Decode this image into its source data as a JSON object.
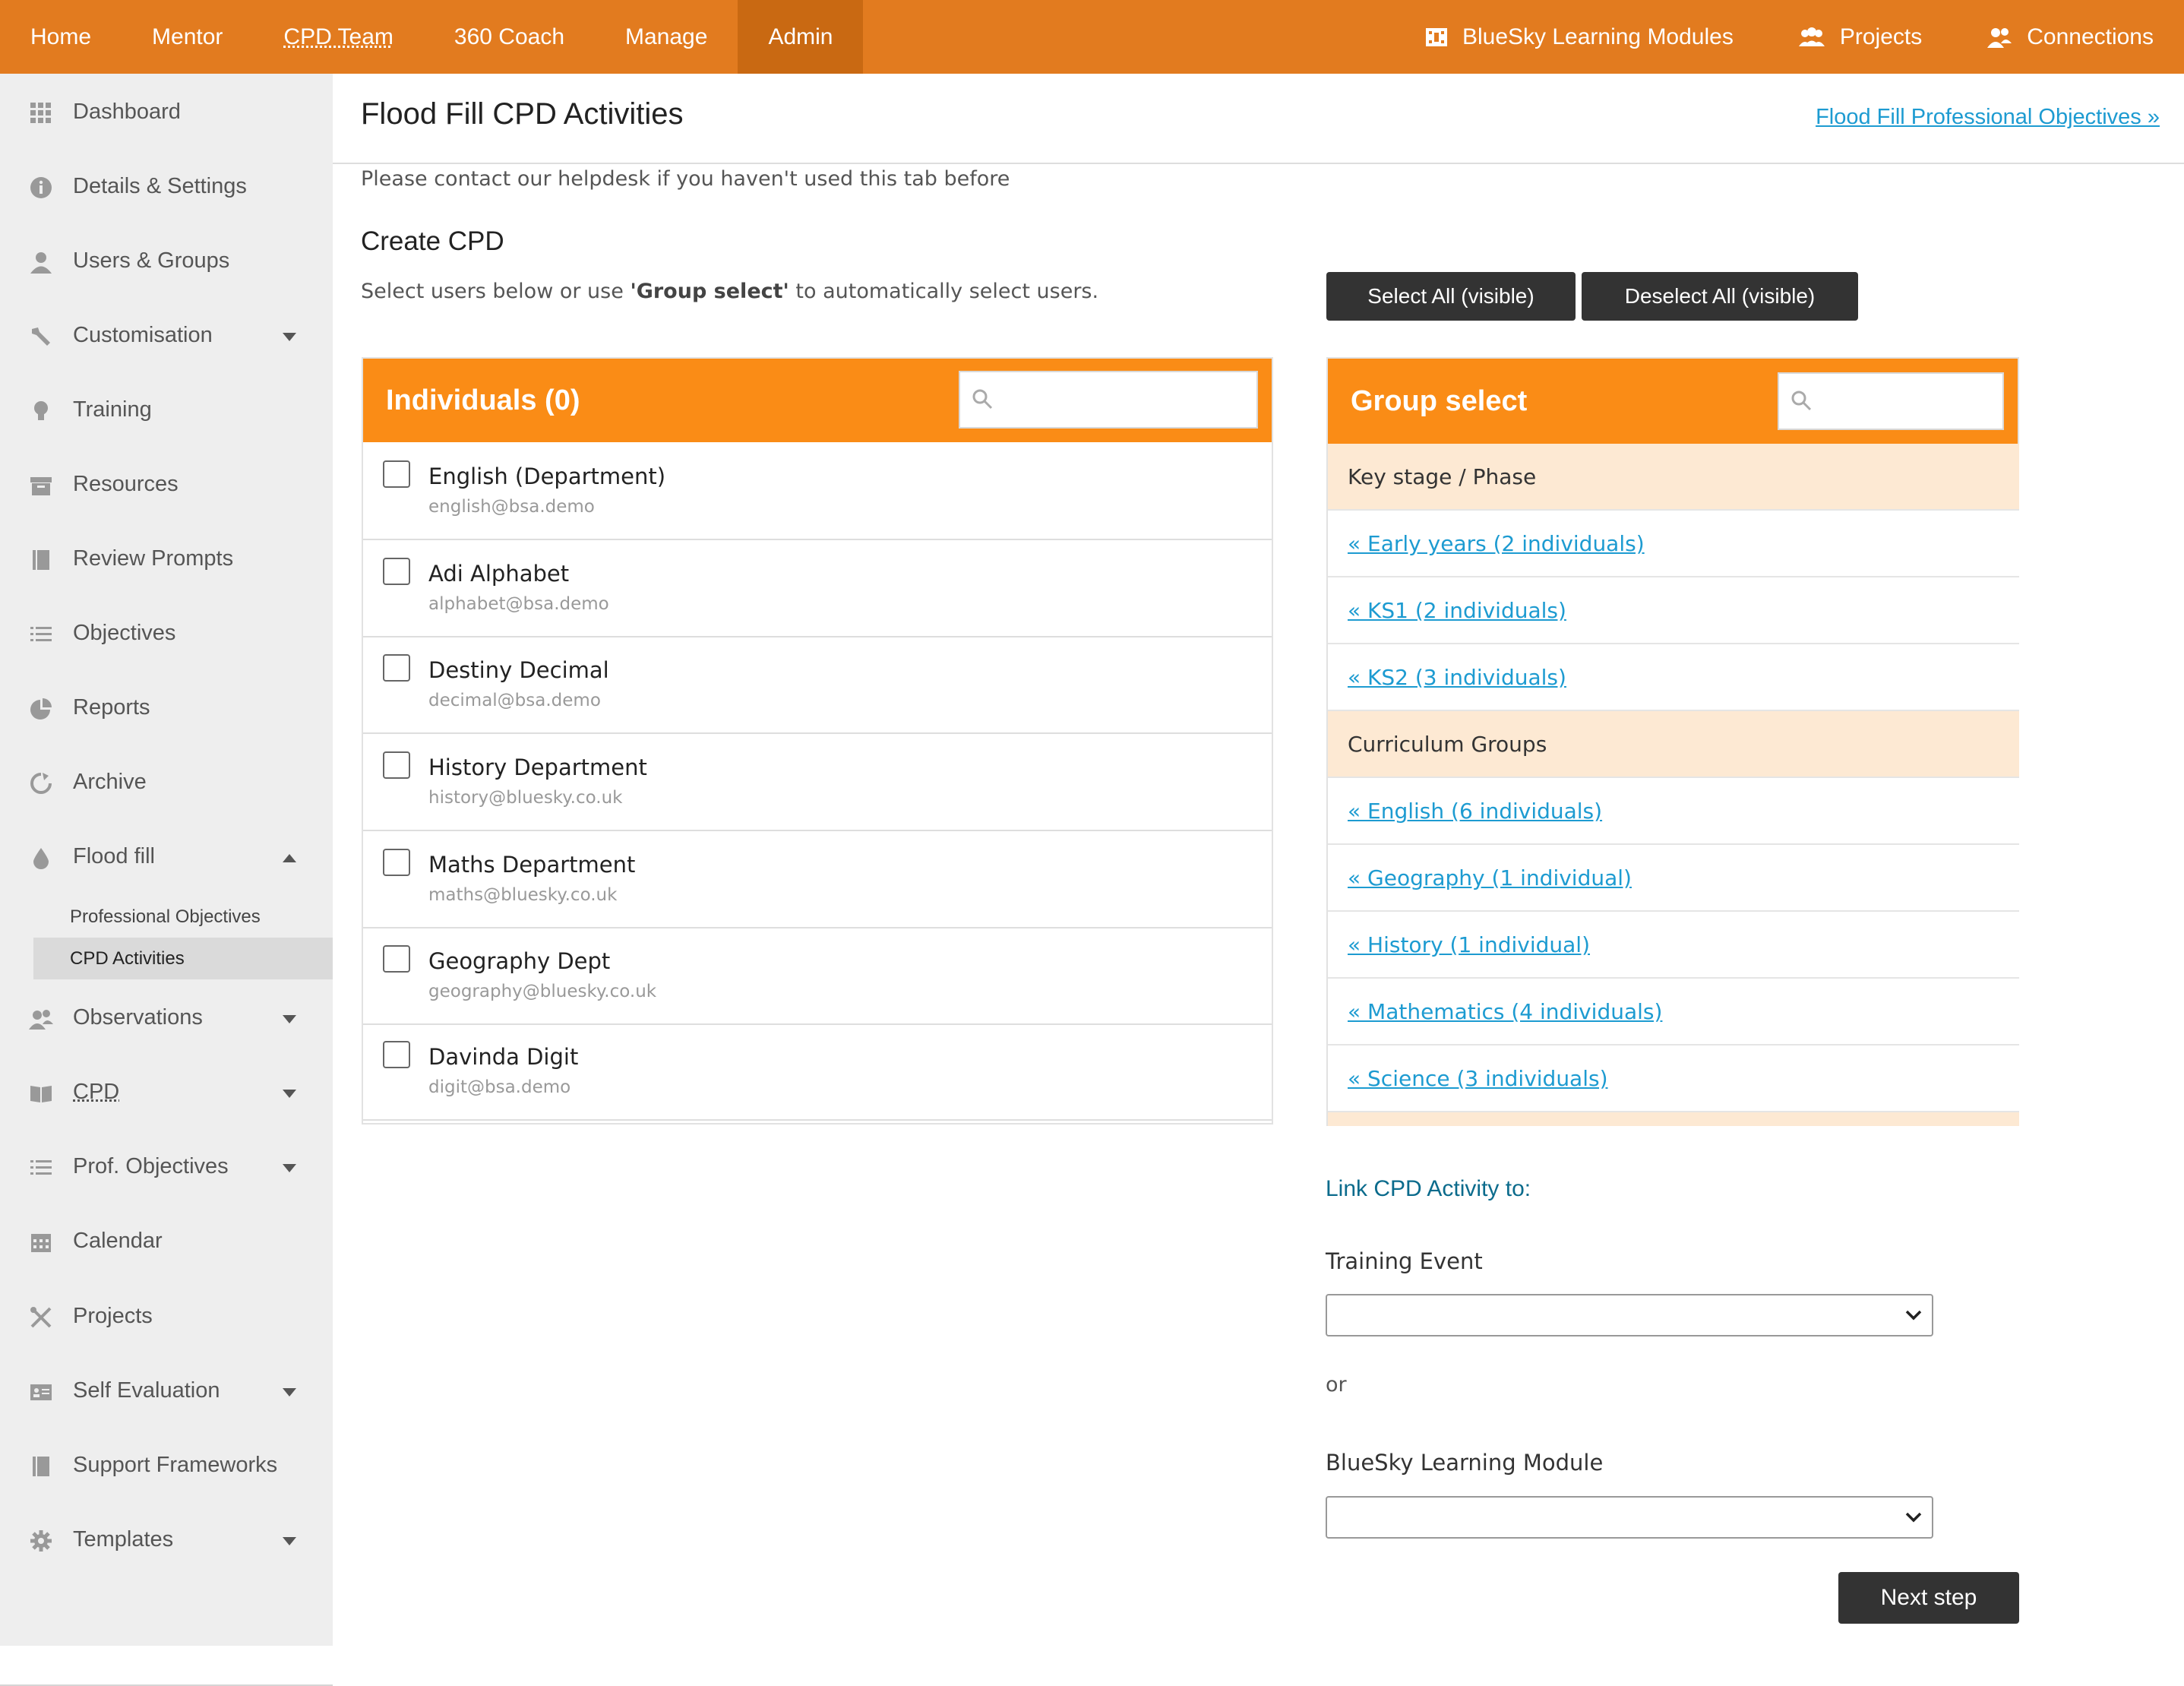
{
  "topnav": {
    "left": [
      "Home",
      "Mentor",
      "CPD Team",
      "360 Coach",
      "Manage",
      "Admin"
    ],
    "active": "Admin",
    "right": {
      "modules": "BlueSky Learning Modules",
      "projects": "Projects",
      "connections": "Connections"
    }
  },
  "sidebar": {
    "items": [
      {
        "label": "Dashboard",
        "icon": "dashboard-icon"
      },
      {
        "label": "Details & Settings",
        "icon": "info-icon"
      },
      {
        "label": "Users & Groups",
        "icon": "user-icon"
      },
      {
        "label": "Customisation",
        "icon": "wrench-icon"
      },
      {
        "label": "Training",
        "icon": "lightbulb-icon"
      },
      {
        "label": "Resources",
        "icon": "archive-box-icon"
      },
      {
        "label": "Review Prompts",
        "icon": "book-icon"
      },
      {
        "label": "Objectives",
        "icon": "list-icon"
      },
      {
        "label": "Reports",
        "icon": "pie-chart-icon"
      },
      {
        "label": "Archive",
        "icon": "refresh-icon"
      },
      {
        "label": "Flood fill",
        "icon": "droplet-icon"
      },
      {
        "label": "Observations",
        "icon": "users-icon"
      },
      {
        "label": "CPD",
        "icon": "open-book-icon"
      },
      {
        "label": "Prof. Objectives",
        "icon": "list-icon"
      },
      {
        "label": "Calendar",
        "icon": "calendar-icon"
      },
      {
        "label": "Projects",
        "icon": "tools-icon"
      },
      {
        "label": "Self Evaluation",
        "icon": "id-card-icon"
      },
      {
        "label": "Support Frameworks",
        "icon": "book-icon"
      },
      {
        "label": "Templates",
        "icon": "gear-icon"
      }
    ],
    "subitems": [
      "Professional Objectives",
      "CPD Activities"
    ],
    "active_sub": "CPD Activities"
  },
  "header": {
    "title": "Flood Fill CPD Activities",
    "link": "Flood Fill Professional Objectives »"
  },
  "helptext": "Please contact our helpdesk if you haven't used this tab before",
  "create": {
    "title": "Create CPD",
    "hint_pre": "Select users below or use ",
    "hint_bold": "'Group select'",
    "hint_post": " to automatically select users."
  },
  "buttons": {
    "select_all": "Select All (visible)",
    "deselect_all": "Deselect All (visible)",
    "next": "Next step"
  },
  "individuals": {
    "title": "Individuals (0)",
    "search_value": "",
    "rows": [
      {
        "name": "English (Department)",
        "email": "english@bsa.demo"
      },
      {
        "name": "Adi Alphabet",
        "email": "alphabet@bsa.demo"
      },
      {
        "name": "Destiny Decimal",
        "email": "decimal@bsa.demo"
      },
      {
        "name": "History Department",
        "email": "history@bluesky.co.uk"
      },
      {
        "name": "Maths Department",
        "email": "maths@bluesky.co.uk"
      },
      {
        "name": "Geography Dept",
        "email": "geography@bluesky.co.uk"
      },
      {
        "name": "Davinda Digit",
        "email": "digit@bsa.demo"
      }
    ]
  },
  "group_select": {
    "title": "Group select",
    "search_value": "",
    "rows": [
      {
        "type": "head",
        "label": "Key stage / Phase"
      },
      {
        "type": "link",
        "label": "« Early years (2 individuals)"
      },
      {
        "type": "link",
        "label": "« KS1 (2 individuals)"
      },
      {
        "type": "link",
        "label": "« KS2 (3 individuals)"
      },
      {
        "type": "head",
        "label": "Curriculum Groups"
      },
      {
        "type": "link",
        "label": "« English (6 individuals)"
      },
      {
        "type": "link",
        "label": "« Geography (1 individual)"
      },
      {
        "type": "link",
        "label": "« History (1 individual)"
      },
      {
        "type": "link",
        "label": "« Mathematics (4 individuals)"
      },
      {
        "type": "link",
        "label": "« Science (3 individuals)"
      }
    ]
  },
  "link_cpd": {
    "title": "Link CPD Activity to:",
    "training_label": "Training Event",
    "training_value": "",
    "or": "or",
    "module_label": "BlueSky Learning Module",
    "module_value": ""
  },
  "colors": {
    "topbar": "#e27b1f",
    "topbar_active": "#c96912",
    "panel_header": "#fa8c16",
    "group_head_bg": "#fde9d3",
    "link": "#1d9bd1",
    "dark_button": "#333333",
    "sidebar_bg": "#eeeeee"
  }
}
